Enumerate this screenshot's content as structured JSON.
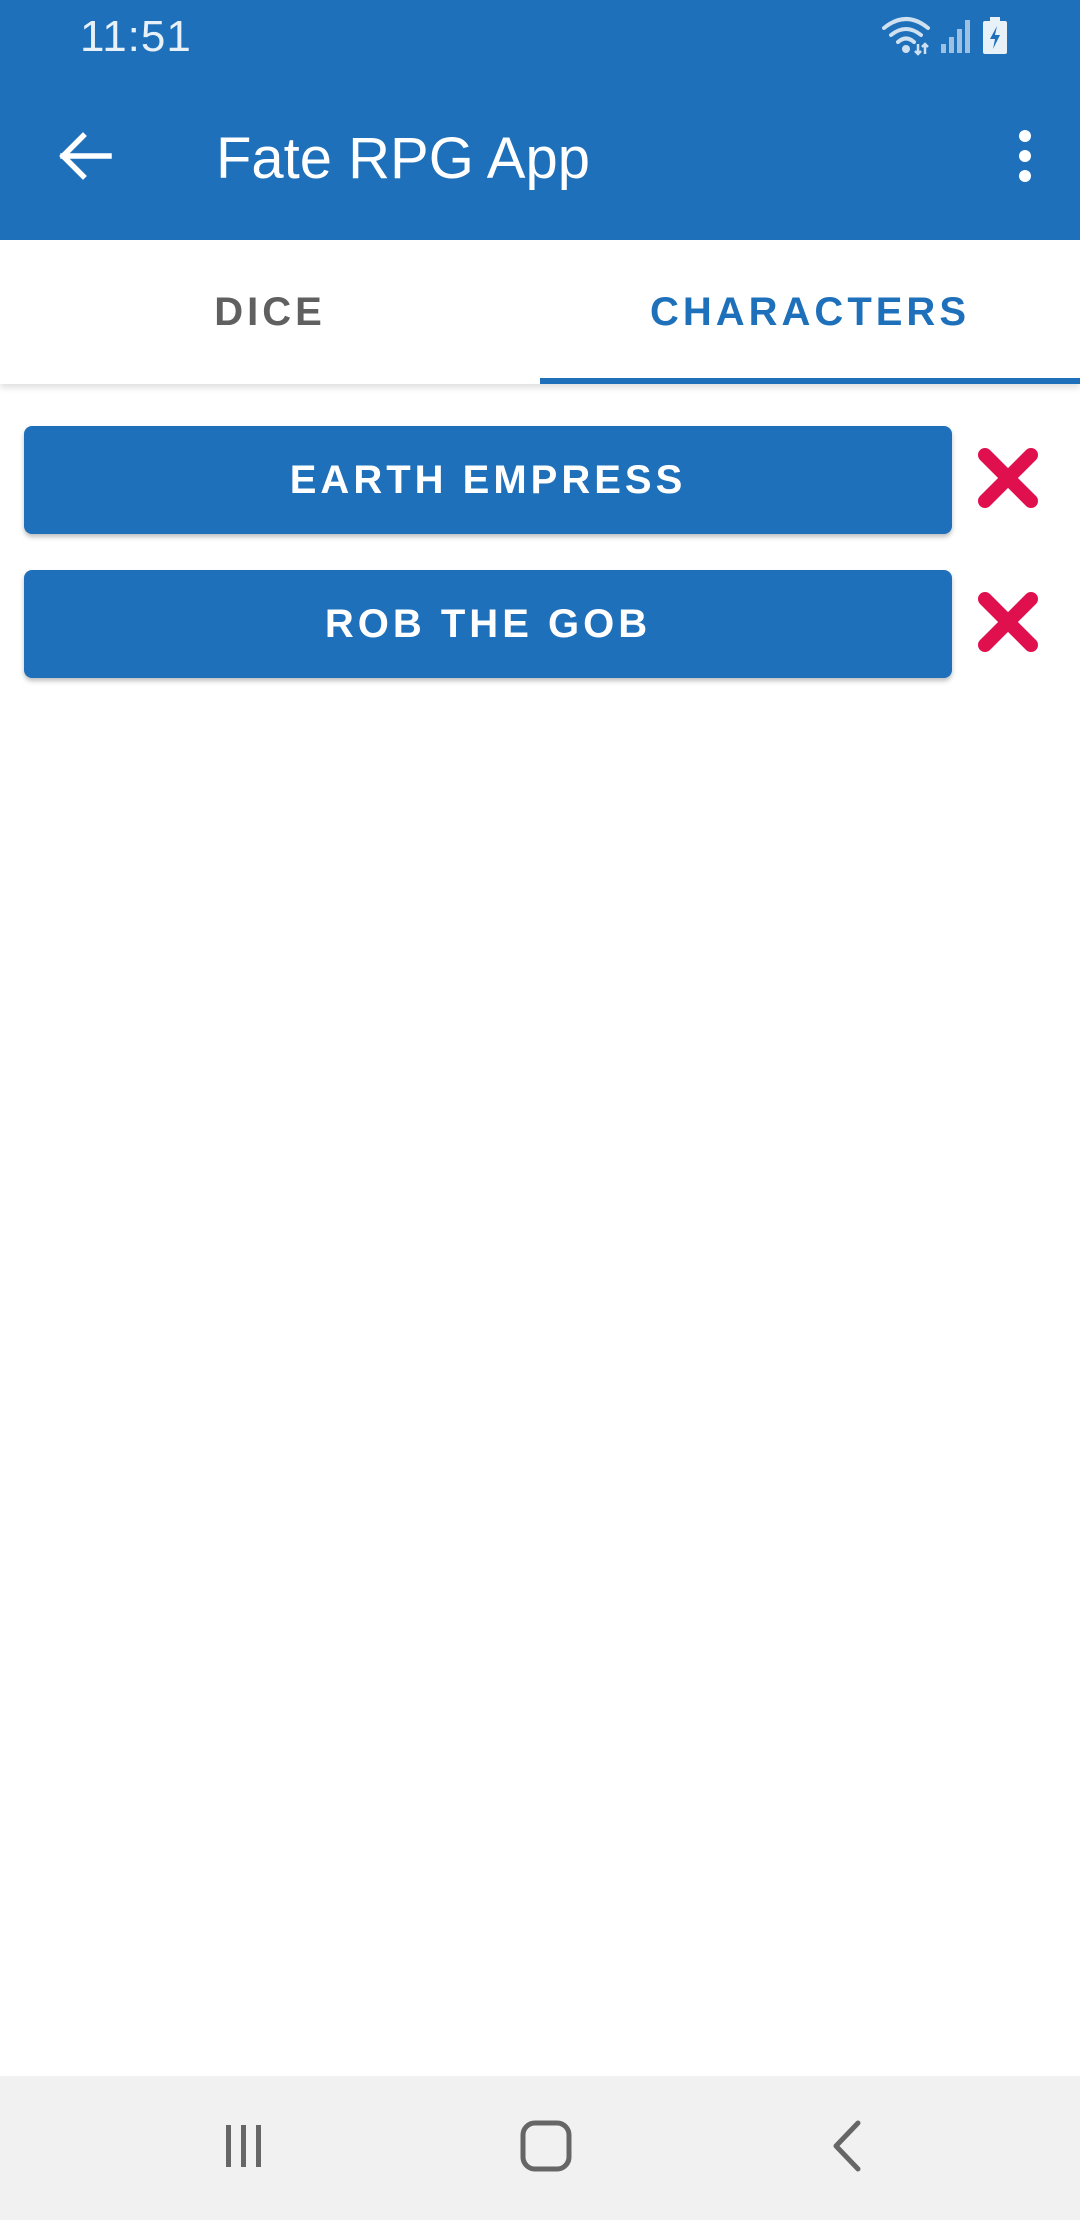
{
  "status_bar": {
    "time": "11:51",
    "icons": [
      "wifi-icon",
      "signal-icon",
      "battery-charging-icon"
    ]
  },
  "app_bar": {
    "title": "Fate RPG App",
    "back_icon": "arrow-back-icon",
    "overflow_icon": "more-vert-icon"
  },
  "tabs": [
    {
      "label": "DICE",
      "selected": false
    },
    {
      "label": "CHARACTERS",
      "selected": true
    }
  ],
  "characters": [
    {
      "name": "EARTH EMPRESS",
      "delete_icon": "close-x-icon"
    },
    {
      "name": "ROB THE GOB",
      "delete_icon": "close-x-icon"
    }
  ],
  "nav_bar": {
    "buttons": [
      "recent-apps-icon",
      "home-icon",
      "back-chevron-icon"
    ]
  },
  "colors": {
    "primary": "#1e70ba",
    "delete": "#e0104f",
    "tab_inactive": "#606060",
    "nav_background": "#f1f1f1"
  }
}
